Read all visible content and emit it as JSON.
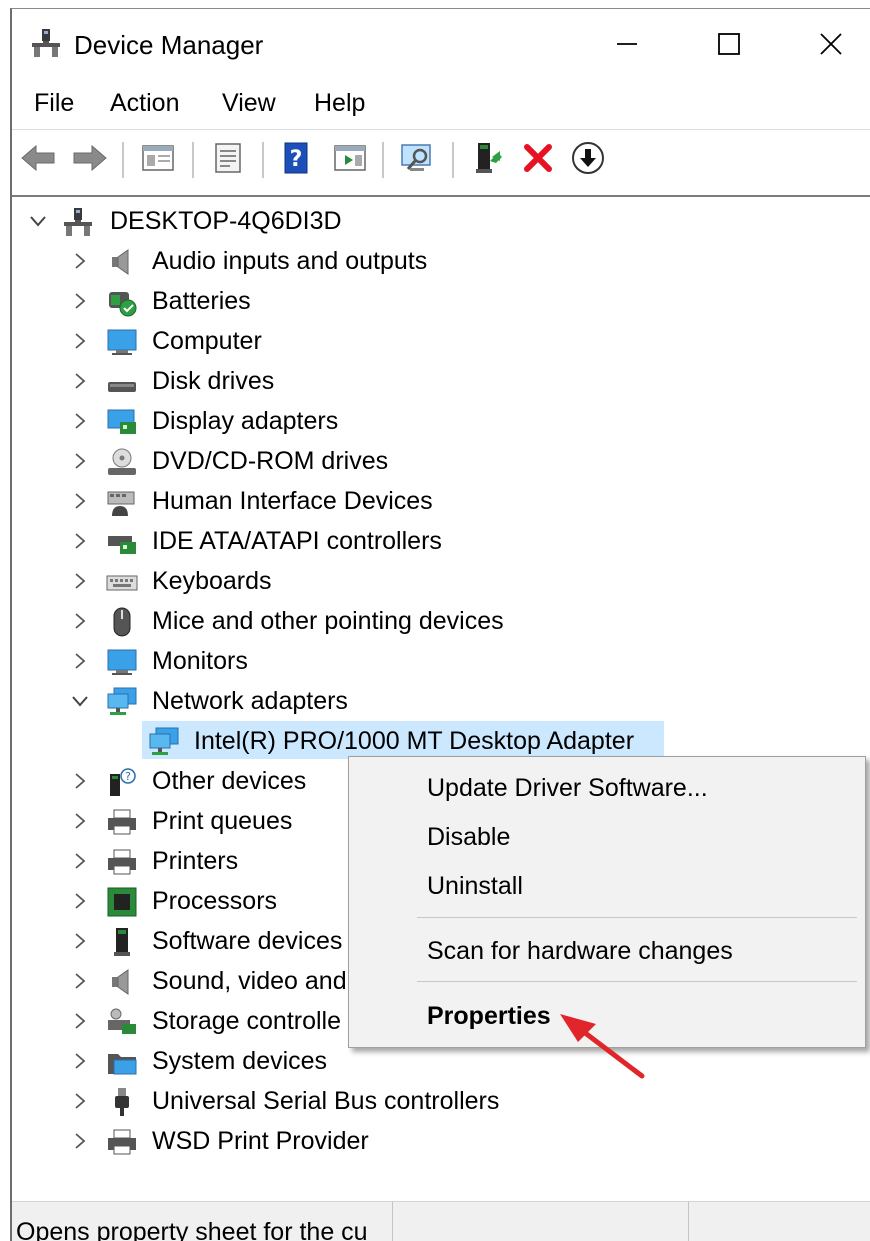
{
  "window": {
    "title": "Device Manager"
  },
  "menubar": {
    "items": [
      "File",
      "Action",
      "View",
      "Help"
    ]
  },
  "toolbar": {
    "buttons": [
      "back-arrow-icon",
      "forward-arrow-icon",
      "show-hide-console-tree-icon",
      "properties-icon",
      "help-icon",
      "action-pane-icon",
      "scan-hardware-icon",
      "update-driver-icon",
      "uninstall-icon",
      "disable-icon"
    ],
    "accent_red": "#e81123"
  },
  "tree": {
    "root": "DESKTOP-4Q6DI3D",
    "categories": [
      "Audio inputs and outputs",
      "Batteries",
      "Computer",
      "Disk drives",
      "Display adapters",
      "DVD/CD-ROM drives",
      "Human Interface Devices",
      "IDE ATA/ATAPI controllers",
      "Keyboards",
      "Mice and other pointing devices",
      "Monitors",
      "Network adapters",
      "Other devices",
      "Print queues",
      "Printers",
      "Processors",
      "Software devices",
      "Sound, video and",
      "Storage controlle",
      "System devices",
      "Universal Serial Bus controllers",
      "WSD Print Provider"
    ],
    "selected_device": "Intel(R) PRO/1000 MT Desktop Adapter",
    "selection_color": "#cce8ff"
  },
  "context_menu": {
    "update": "Update Driver Software...",
    "disable": "Disable",
    "uninstall": "Uninstall",
    "scan": "Scan for hardware changes",
    "properties": "Properties"
  },
  "annotation": {
    "arrow_color": "#e0262a"
  },
  "status": {
    "text": "Opens property sheet for the cu"
  }
}
